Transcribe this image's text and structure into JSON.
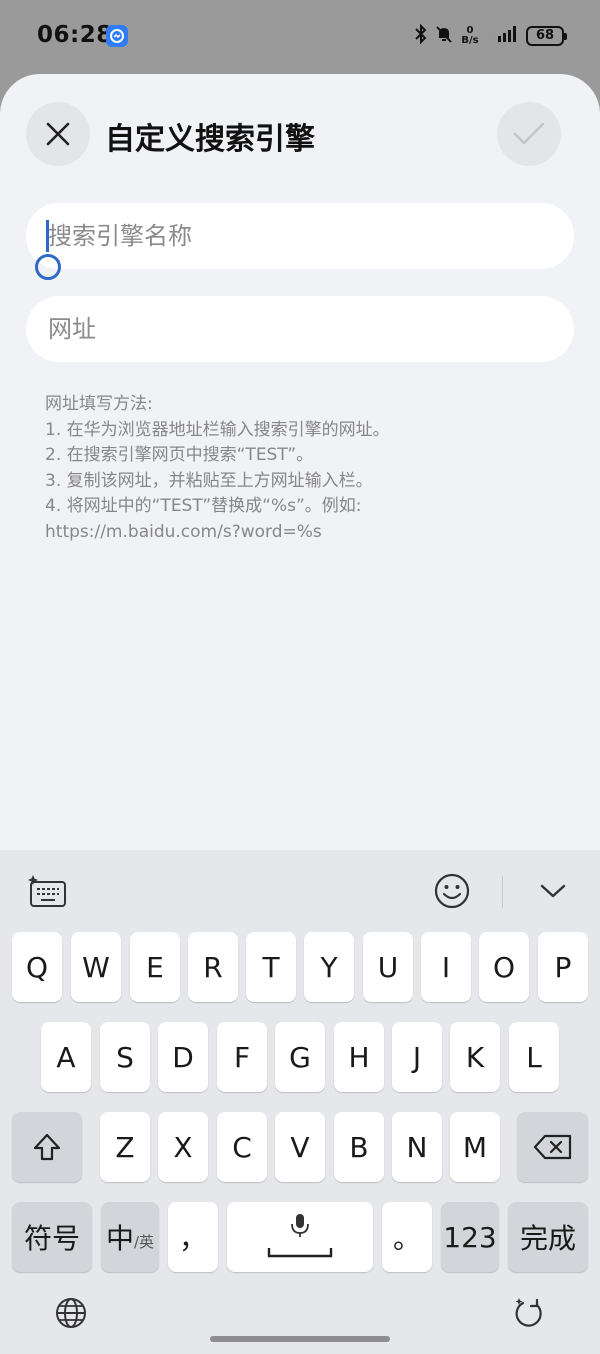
{
  "status_bar": {
    "time": "06:28",
    "net_speed_value": "0",
    "net_speed_unit": "B/s",
    "battery": "68"
  },
  "dialog": {
    "title": "自定义搜索引擎",
    "name_placeholder": "搜索引擎名称",
    "url_placeholder": "网址",
    "help_lines": [
      "网址填写方法:",
      "1. 在华为浏览器地址栏输入搜索引擎的网址。",
      "2. 在搜索引擎网页中搜索“TEST”。",
      "3. 复制该网址，并粘贴至上方网址输入栏。",
      "4. 将网址中的“TEST”替换成“%s”。例如:",
      "https://m.baidu.com/s?word=%s"
    ]
  },
  "keyboard": {
    "row1": [
      "Q",
      "W",
      "E",
      "R",
      "T",
      "Y",
      "U",
      "I",
      "O",
      "P"
    ],
    "row2": [
      "A",
      "S",
      "D",
      "F",
      "G",
      "H",
      "J",
      "K",
      "L"
    ],
    "row3": [
      "Z",
      "X",
      "C",
      "V",
      "B",
      "N",
      "M"
    ],
    "symbols_label": "符号",
    "lang_main": "中",
    "lang_sub": "/英",
    "comma": "，",
    "period": "。",
    "numbers_label": "123",
    "done_label": "完成"
  },
  "colors": {
    "accent": "#2f68c8",
    "sheet_background": "#f1f2f5",
    "keyboard_background": "#e6e7eb"
  }
}
